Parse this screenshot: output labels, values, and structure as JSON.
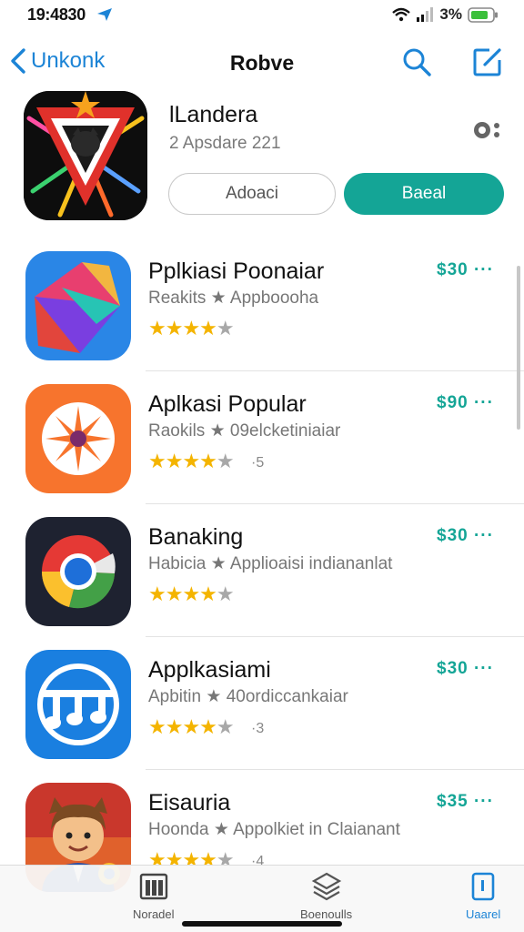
{
  "status": {
    "time": "19:4830",
    "battery": "3%"
  },
  "nav": {
    "back_label": "Unkonk",
    "title": "Robve"
  },
  "featured": {
    "name": "lLandera",
    "subtitle": "2 Apsdare 221",
    "secondary_button": "Adoaci",
    "primary_button": "Baeal"
  },
  "apps": [
    {
      "name": "Pplkiasi Poonaiar",
      "category": "Reakits",
      "subtitle": "Appboooha",
      "rating": 4,
      "count": "",
      "price": "$30"
    },
    {
      "name": "Aplkasi Popular",
      "category": "Raokils",
      "subtitle": "09elcketiniaiar",
      "rating": 4,
      "count": "·5",
      "price": "$90"
    },
    {
      "name": "Banaking",
      "category": "Habicia",
      "subtitle": "Applioaisi indiananlat",
      "rating": 4,
      "count": "",
      "price": "$30"
    },
    {
      "name": "Applkasiami",
      "category": "Apbitin",
      "subtitle": "40ordiccankaiar",
      "rating": 4,
      "count": "·3",
      "price": "$30"
    },
    {
      "name": "Eisauria",
      "category": "Hoonda",
      "subtitle": "Appolkiet in Claianant",
      "rating": 4,
      "count": "·4",
      "price": "$35"
    }
  ],
  "tabs": [
    {
      "label": "Noradel"
    },
    {
      "label": "Boenoulls"
    },
    {
      "label": "Uaarel"
    }
  ],
  "colors": {
    "accent": "#14a596",
    "link": "#1c84d6",
    "star": "#f4b400"
  },
  "icons": {
    "featured": "wolf-shield-app-icon",
    "apps": [
      "geometric-prism-app-icon",
      "sunburst-app-icon",
      "chrome-ring-app-icon",
      "music-notes-app-icon",
      "cartoon-avatar-app-icon"
    ]
  }
}
